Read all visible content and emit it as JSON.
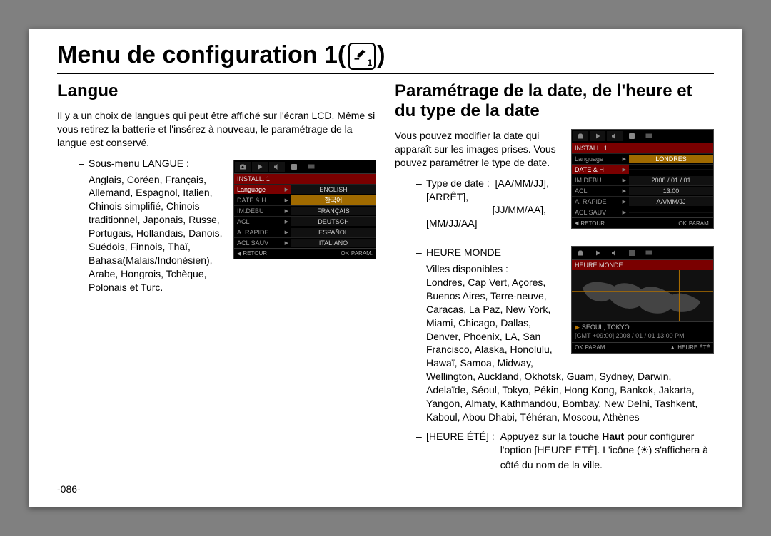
{
  "page_title": "Menu de configuration 1(",
  "page_title_close": ")",
  "page_number": "-086-",
  "left": {
    "heading": "Langue",
    "intro": "Il y a un choix de langues qui peut être affiché sur l'écran LCD. Même si vous retirez la batterie et l'insérez à nouveau, le paramétrage de la langue est conservé.",
    "submenu_label": "Sous-menu LANGUE :",
    "submenu_body": "Anglais, Coréen, Français, Allemand, Espagnol, Italien, Chinois simplifié, Chinois traditionnel, Japonais, Russe, Portugais, Hollandais, Danois, Suédois, Finnois, Thaï, Bahasa(Malais/Indonésien), Arabe, Hongrois, Tchèque, Polonais et Turc.",
    "lcd": {
      "header": "INSTALL. 1",
      "rows": [
        {
          "l": "Language",
          "r": "ENGLISH",
          "hi_r": false
        },
        {
          "l": "DATE & H",
          "r": "한국어",
          "hi_r": true
        },
        {
          "l": "IM.DEBU",
          "r": "FRANÇAIS",
          "hi_r": false
        },
        {
          "l": "ACL",
          "r": "DEUTSCH",
          "hi_r": false
        },
        {
          "l": "A. RAPIDE",
          "r": "ESPAÑOL",
          "hi_r": false
        },
        {
          "l": "ACL SAUV",
          "r": "ITALIANO",
          "hi_r": false
        }
      ],
      "foot_left": "RETOUR",
      "foot_right_ok": "OK",
      "foot_right": "PARAM."
    }
  },
  "right": {
    "heading": "Paramétrage de la date, de l'heure et du type de la date",
    "intro": "Vous pouvez modifier la date qui apparaît sur les images prises. Vous pouvez paramétrer le type de date.",
    "type_date_label": "Type de date :",
    "type_date_line1": "[AA/MM/JJ], [ARRÊT],",
    "type_date_line2": "[JJ/MM/AA], [MM/JJ/AA]",
    "lcd": {
      "header": "INSTALL. 1",
      "rows": [
        {
          "l": "Language",
          "r": "LONDRES",
          "hi_l": false,
          "hi_r": true
        },
        {
          "l": "DATE & H",
          "r": "",
          "hi_l": true
        },
        {
          "l": "IM.DEBU",
          "r": "2008 / 01 / 01"
        },
        {
          "l": "ACL",
          "r": "13:00"
        },
        {
          "l": "A. RAPIDE",
          "r": "AA/MM/JJ"
        },
        {
          "l": "ACL SAUV",
          "r": ""
        }
      ],
      "foot_left": "RETOUR",
      "foot_right_ok": "OK",
      "foot_right": "PARAM."
    },
    "heure_monde_label": "HEURE MONDE",
    "villes_label": "Villes disponibles :",
    "villes_body": "Londres, Cap Vert, Açores, Buenos Aires, Terre-neuve, Caracas, La Paz, New York, Miami, Chicago, Dallas, Denver, Phoenix, LA, San Francisco, Alaska, Honolulu, Hawaï, Samoa, Midway, Wellington, Auckland, Okhotsk, Guam, Sydney, Darwin,",
    "villes_body2": "Adelaïde, Séoul, Tokyo, Pékin, Hong Kong, Bankok, Jakarta, Yangon, Almaty, Kathmandou, Bombay, New Delhi, Tashkent, Kaboul, Abou Dhabi, Téhéran, Moscou, Athènes",
    "world": {
      "header": "HEURE MONDE",
      "city": "SÉOUL, TOKYO",
      "gmt": "[GMT +09:00] 2008 / 01 / 01  13:00 PM",
      "foot_left_ok": "OK",
      "foot_left": "PARAM.",
      "foot_right": "HEURE ÉTÉ"
    },
    "heure_ete_label": "[HEURE ÉTÉ] :",
    "heure_ete_body1": "Appuyez sur la touche ",
    "heure_ete_bold": "Haut",
    "heure_ete_body2": " pour configurer l'option [HEURE ÉTÉ]. L'icône (",
    "heure_ete_body3": ") s'affichera à côté du nom de la ville."
  }
}
